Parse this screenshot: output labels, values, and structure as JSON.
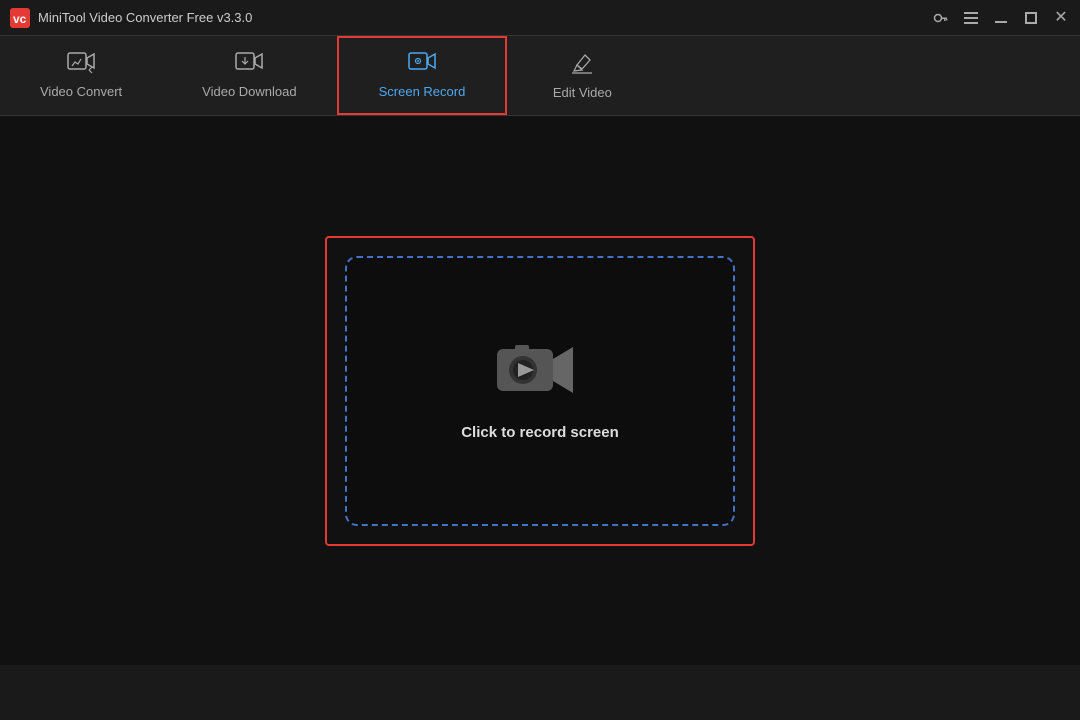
{
  "app": {
    "title": "MiniTool Video Converter Free v3.3.0",
    "logo_color": "#e53935"
  },
  "titlebar": {
    "key_icon": "🔑",
    "minimize_label": "minimize",
    "maximize_label": "maximize",
    "close_label": "close"
  },
  "nav": {
    "tabs": [
      {
        "id": "video-convert",
        "label": "Video Convert",
        "active": false
      },
      {
        "id": "video-download",
        "label": "Video Download",
        "active": false
      },
      {
        "id": "screen-record",
        "label": "Screen Record",
        "active": true
      },
      {
        "id": "edit-video",
        "label": "Edit Video",
        "active": false
      }
    ]
  },
  "main": {
    "record_prompt": "Click to record screen"
  }
}
